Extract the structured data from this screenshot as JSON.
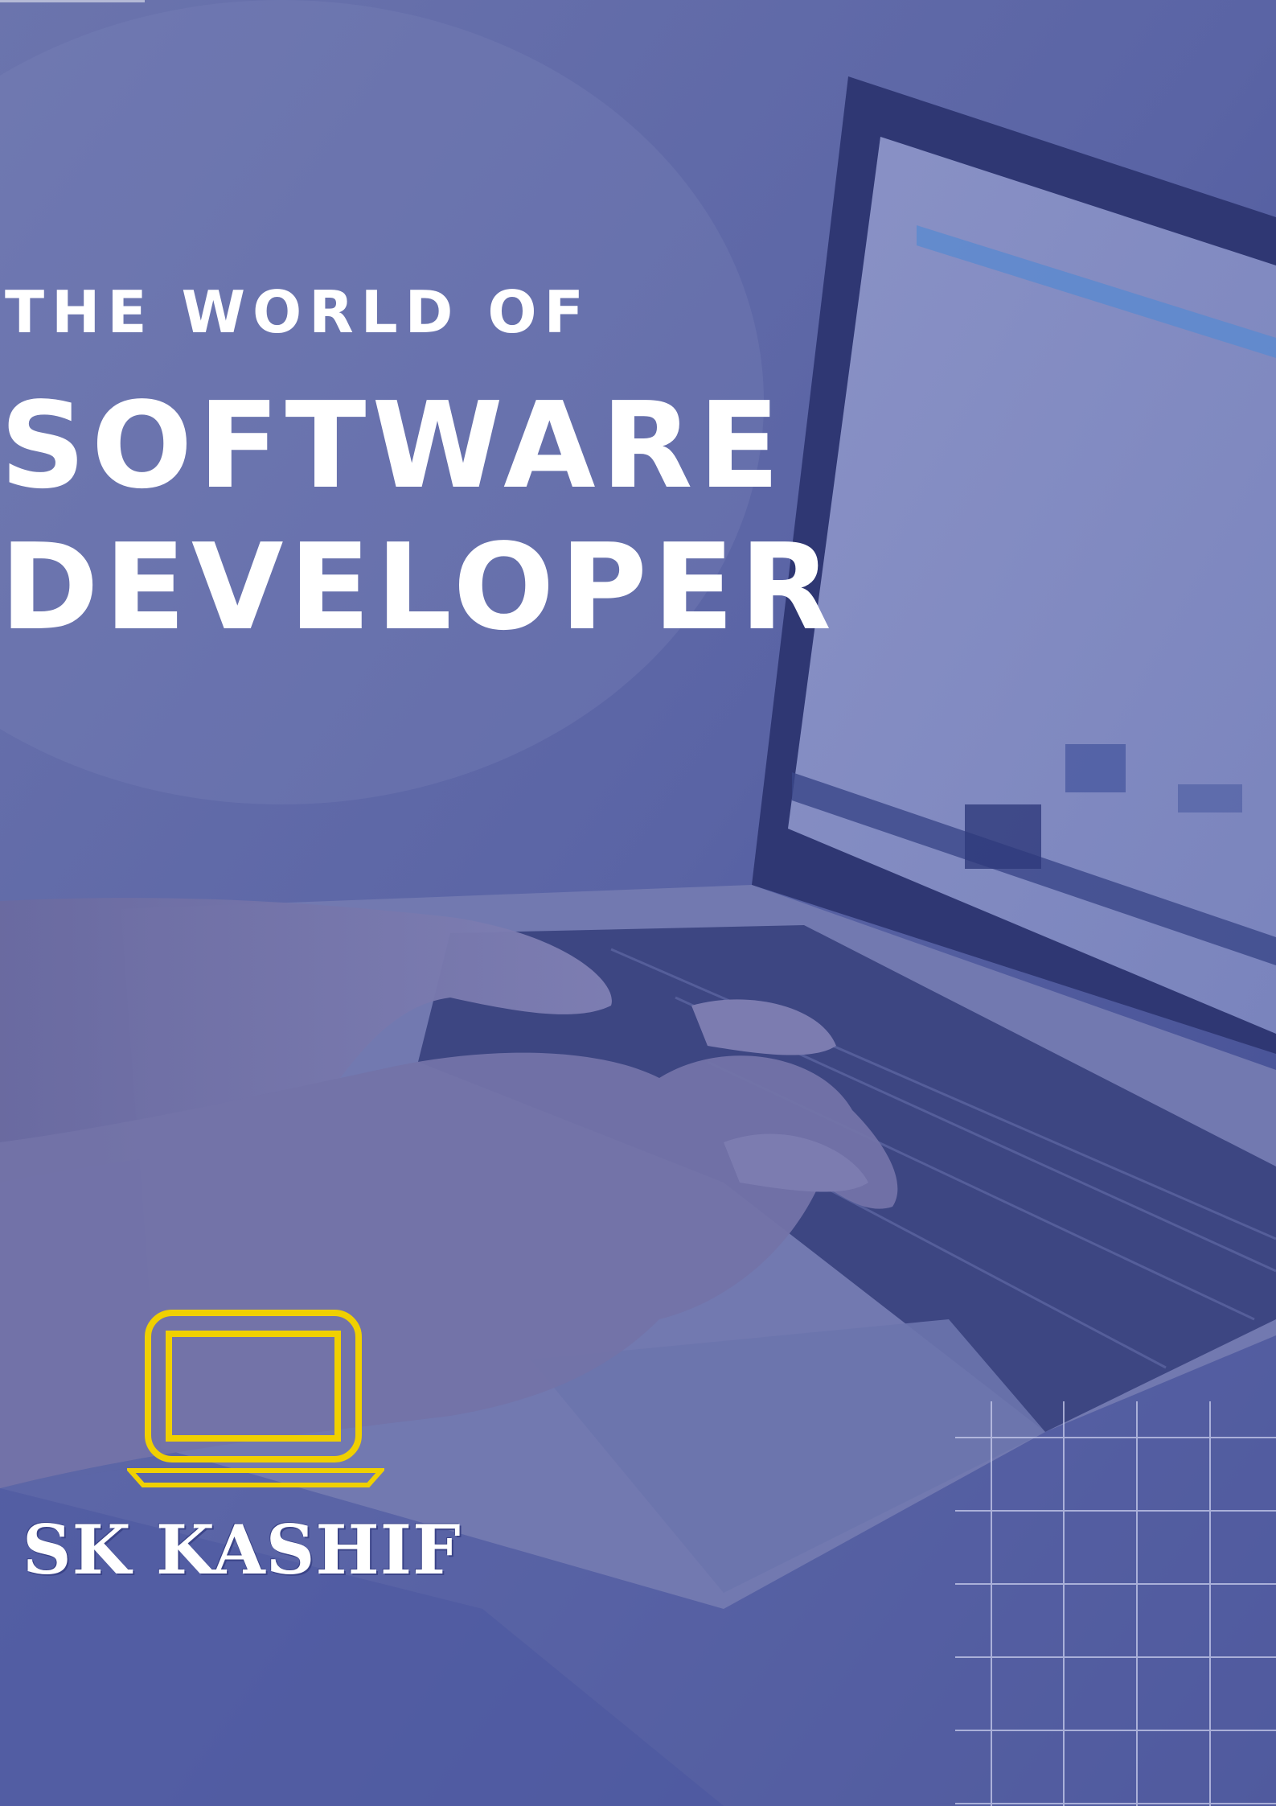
{
  "cover": {
    "title_line1": "THE WORLD OF",
    "title_line2": "SOFTWARE",
    "title_line3": "DEVELOPER",
    "author": "SK KASHIF"
  },
  "colors": {
    "overlay": "#5a64a6",
    "title_text": "#ffffff",
    "logo_accent": "#f0d000"
  },
  "icons": {
    "logo": "laptop-icon"
  }
}
